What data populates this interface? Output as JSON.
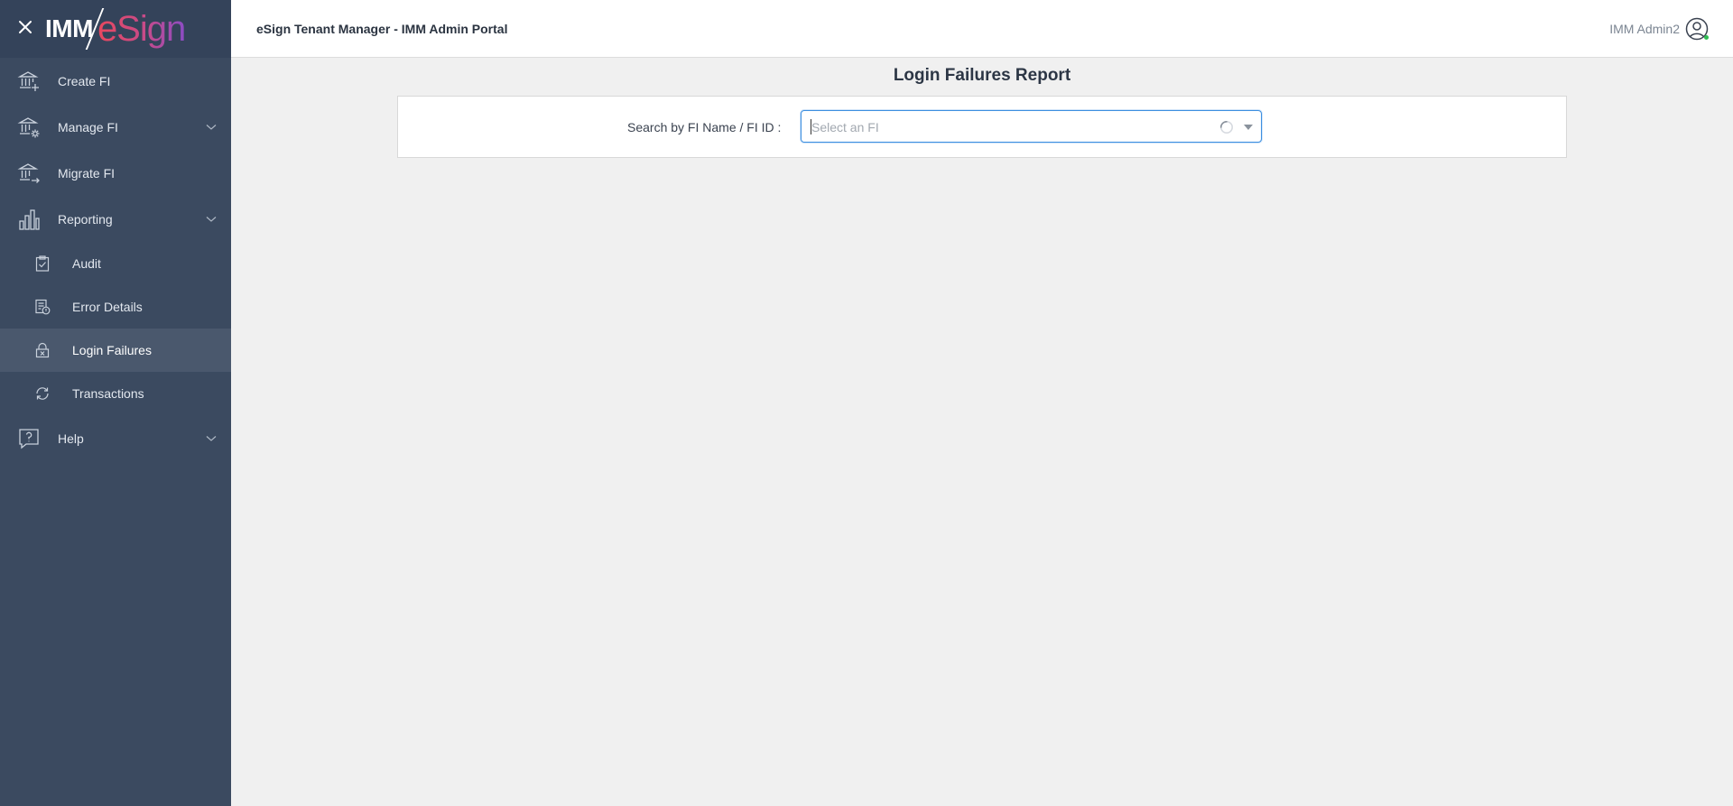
{
  "app": {
    "logo_imm": "IMM",
    "logo_esign": "eSign",
    "header_title": "eSign Tenant Manager - IMM Admin Portal",
    "user_name": "IMM Admin2"
  },
  "sidebar": {
    "items": [
      {
        "label": "Create FI",
        "icon": "bank-add-icon"
      },
      {
        "label": "Manage FI",
        "icon": "bank-settings-icon",
        "expandable": true
      },
      {
        "label": "Migrate FI",
        "icon": "bank-migrate-icon"
      },
      {
        "label": "Reporting",
        "icon": "bar-chart-icon",
        "expandable": true
      },
      {
        "label": "Help",
        "icon": "help-icon",
        "expandable": true
      }
    ],
    "reporting_sub": [
      {
        "label": "Audit",
        "icon": "clipboard-check-icon"
      },
      {
        "label": "Error Details",
        "icon": "document-error-icon"
      },
      {
        "label": "Login Failures",
        "icon": "lock-x-icon",
        "active": true
      },
      {
        "label": "Transactions",
        "icon": "sync-icon"
      }
    ]
  },
  "main": {
    "page_title": "Login Failures Report",
    "search_label": "Search by FI Name / FI ID :",
    "select_placeholder": "Select an FI"
  },
  "colors": {
    "sidebar_bg": "#3b4a60",
    "active_item_bg": "#4a586d",
    "accent_focus": "#3d8fe0",
    "logo_gradient_start": "#e8485e",
    "logo_gradient_end": "#8c4cc4"
  }
}
